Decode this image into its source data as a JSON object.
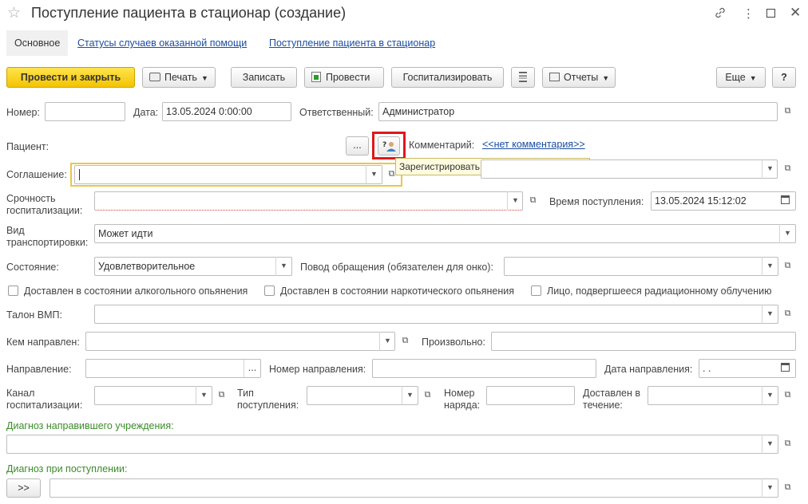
{
  "window": {
    "title": "Поступление пациента в стационар (создание)",
    "icons": [
      "star-icon",
      "link-icon",
      "more-vert-icon",
      "maximize-icon",
      "close-icon"
    ]
  },
  "nav": {
    "tabs": [
      "Основное",
      "Статусы случаев оказанной помощи",
      "Поступление пациента в стационар"
    ]
  },
  "toolbar": {
    "post_close": "Провести и закрыть",
    "print": "Печать",
    "save": "Записать",
    "post": "Провести",
    "hospitalize": "Госпитализировать",
    "reports": "Отчеты",
    "more": "Еще",
    "help": "?"
  },
  "form": {
    "number": {
      "label": "Номер:",
      "value": ""
    },
    "date": {
      "label": "Дата:",
      "value": "13.05.2024  0:00:00"
    },
    "responsible": {
      "label": "Ответственный:",
      "value": "Администратор"
    },
    "patient": {
      "label": "Пациент:",
      "choose": "..."
    },
    "comment": {
      "label": "Комментарий:",
      "link": "<<нет комментария>>"
    },
    "tooltip": "Зарегистрировать неизвестного пациента",
    "agreement": {
      "label": "Соглашение:",
      "value": ""
    },
    "urgency": {
      "label": "Срочность госпитализации:",
      "value": ""
    },
    "arrival_time": {
      "label": "Время поступления:",
      "value": "13.05.2024 15:12:02"
    },
    "transport": {
      "label": "Вид транспортировки:",
      "value": "Может идти"
    },
    "state": {
      "label": "Состояние:",
      "value": "Удовлетворительное"
    },
    "reason": {
      "label": "Повод обращения (обязателен для онко):",
      "value": ""
    },
    "checks": [
      {
        "label": "Доставлен в состоянии алкогольного опьянения",
        "checked": false
      },
      {
        "label": "Доставлен в состоянии наркотического опьянения",
        "checked": false
      },
      {
        "label": "Лицо, подвергшееся радиационному облучению",
        "checked": false
      }
    ],
    "vmp": {
      "label": "Талон ВМП:",
      "value": ""
    },
    "referred_by": {
      "label": "Кем направлен:",
      "value": ""
    },
    "arbitrary": {
      "label": "Произвольно:",
      "value": ""
    },
    "referral": {
      "label": "Направление:",
      "choose": "..."
    },
    "referral_no": {
      "label": "Номер направления:",
      "value": ""
    },
    "referral_date": {
      "label": "Дата направления:",
      "value": " .  ."
    },
    "channel": {
      "label": "Канал госпитализации:",
      "value": ""
    },
    "admission_type": {
      "label": "Тип поступления:",
      "value": ""
    },
    "order_no": {
      "label": "Номер наряда:",
      "value": ""
    },
    "delivered_within": {
      "label": "Доставлен в течение:",
      "value": ""
    },
    "diag_referring": {
      "label": "Диагноз направившего учреждения:",
      "value": ""
    },
    "diag_admission": {
      "label": "Диагноз при поступлении:",
      "value": "",
      "expand": ">>"
    }
  }
}
